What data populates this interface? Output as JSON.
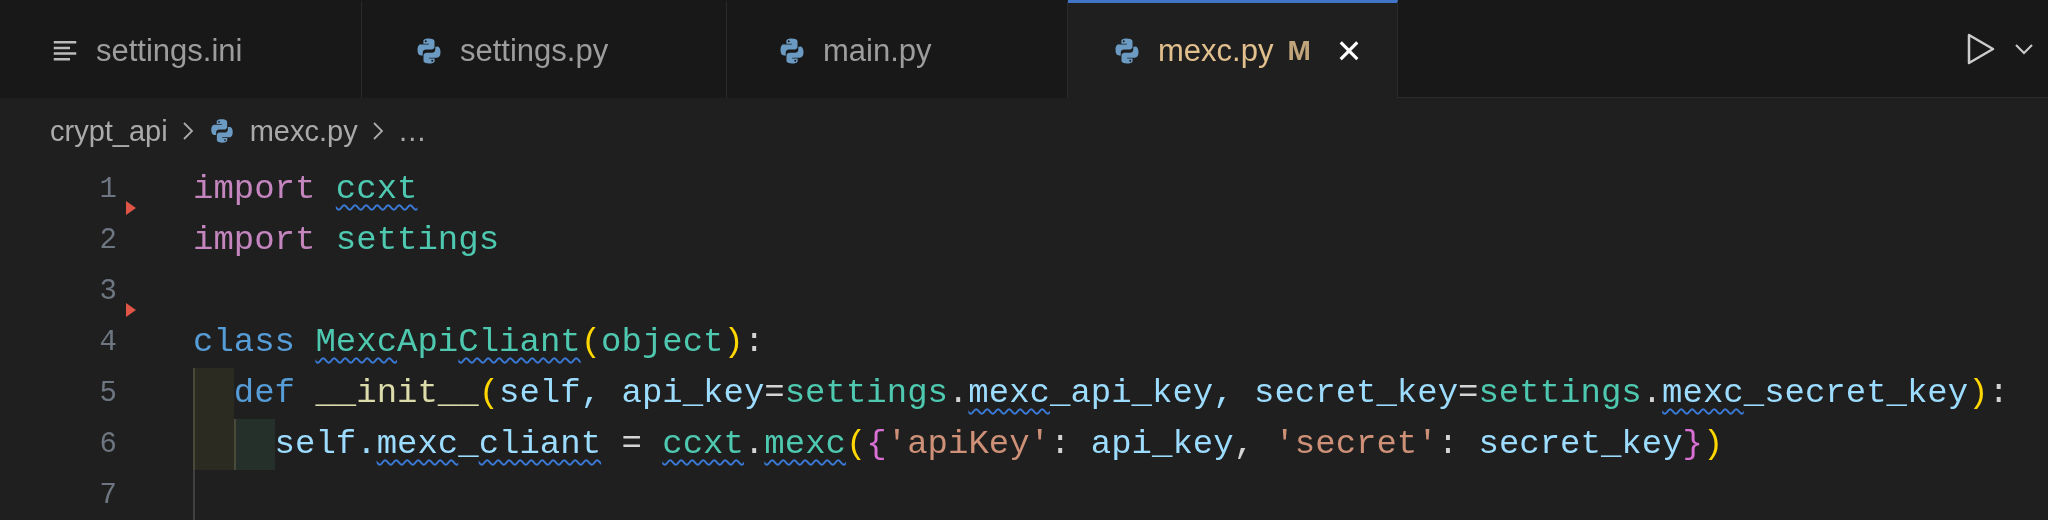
{
  "tabs": [
    {
      "label": "settings.ini",
      "kind": "text",
      "selected": false,
      "modified": false
    },
    {
      "label": "settings.py",
      "kind": "python",
      "selected": false,
      "modified": false
    },
    {
      "label": "main.py",
      "kind": "python",
      "selected": false,
      "modified": false
    },
    {
      "label": "mexc.py",
      "kind": "python",
      "selected": true,
      "modified": true,
      "badge": "M",
      "close": "×"
    }
  ],
  "breadcrumb": [
    {
      "label": "crypt_api",
      "kind": "folder"
    },
    {
      "label": "mexc.py",
      "kind": "python"
    },
    {
      "label": "…",
      "kind": "more"
    }
  ],
  "lines": [
    {
      "number": "1",
      "deleted_above": false,
      "tokens": [
        {
          "text": "import ",
          "kind": "keyword"
        },
        {
          "text": "ccxt",
          "kind": "module",
          "squiggle": true
        }
      ]
    },
    {
      "number": "2",
      "deleted_above": true,
      "tokens": [
        {
          "text": "import ",
          "kind": "keyword"
        },
        {
          "text": "settings",
          "kind": "module"
        }
      ]
    },
    {
      "number": "3",
      "deleted_above": false
    },
    {
      "number": "4",
      "deleted_above": true,
      "tokens": [
        {
          "text": "class ",
          "kind": "storage"
        },
        {
          "text": "Mexc",
          "kind": "module",
          "squiggle": true
        },
        {
          "text": "Api",
          "kind": "module"
        },
        {
          "text": "Cliant",
          "kind": "module",
          "squiggle": true
        },
        {
          "text": "(",
          "kind": "paren"
        },
        {
          "text": "object",
          "kind": "module"
        },
        {
          "text": ")",
          "kind": "paren"
        },
        {
          "text": ":",
          "kind": "punct"
        }
      ]
    },
    {
      "number": "5",
      "deleted_above": false,
      "indent_guides": [
        {
          "shaded": true,
          "color": "#2c2b22"
        }
      ],
      "tokens": [
        {
          "text": "def ",
          "kind": "storage"
        },
        {
          "text": "__init__",
          "kind": "func"
        },
        {
          "text": "(",
          "kind": "paren"
        },
        {
          "text": "self, api_key",
          "kind": "var"
        },
        {
          "text": "=",
          "kind": "punct"
        },
        {
          "text": "settings",
          "kind": "module"
        },
        {
          "text": ".",
          "kind": "punct"
        },
        {
          "text": "mexc",
          "kind": "var",
          "squiggle": true
        },
        {
          "text": "_api_key, secret_key",
          "kind": "var"
        },
        {
          "text": "=",
          "kind": "punct"
        },
        {
          "text": "settings",
          "kind": "module"
        },
        {
          "text": ".",
          "kind": "punct"
        },
        {
          "text": "mexc",
          "kind": "var",
          "squiggle": true
        },
        {
          "text": "_secret_key",
          "kind": "var"
        },
        {
          "text": ")",
          "kind": "paren"
        },
        {
          "text": ":",
          "kind": "punct"
        }
      ]
    },
    {
      "number": "6",
      "deleted_above": false,
      "indent_guides": [
        {
          "shaded": true,
          "color": "#2c2b22"
        },
        {
          "shaded": true,
          "color": "#26302a"
        }
      ],
      "tokens": [
        {
          "text": "self.",
          "kind": "var"
        },
        {
          "text": "mexc",
          "kind": "var",
          "squiggle": true
        },
        {
          "text": "_",
          "kind": "var"
        },
        {
          "text": "cliant",
          "kind": "var",
          "squiggle": true
        },
        {
          "text": " = ",
          "kind": "punct"
        },
        {
          "text": "ccxt",
          "kind": "module",
          "squiggle": true
        },
        {
          "text": ".",
          "kind": "punct"
        },
        {
          "text": "mexc",
          "kind": "module",
          "squiggle": true
        },
        {
          "text": "(",
          "kind": "paren"
        },
        {
          "text": "{",
          "kind": "brace"
        },
        {
          "text": "'apiKey'",
          "kind": "string"
        },
        {
          "text": ": ",
          "kind": "punct"
        },
        {
          "text": "api_key",
          "kind": "var"
        },
        {
          "text": ", ",
          "kind": "punct"
        },
        {
          "text": "'secret'",
          "kind": "string"
        },
        {
          "text": ": ",
          "kind": "punct"
        },
        {
          "text": "secret_key",
          "kind": "var"
        },
        {
          "text": "}",
          "kind": "brace"
        },
        {
          "text": ")",
          "kind": "paren"
        }
      ]
    },
    {
      "number": "7",
      "deleted_above": false,
      "indent_guides": [
        {
          "shaded": false
        }
      ]
    }
  ]
}
